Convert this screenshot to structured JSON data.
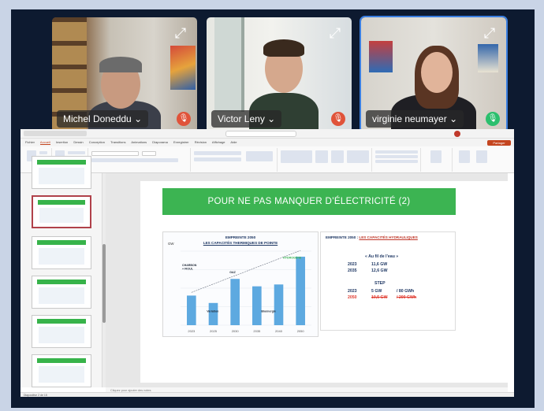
{
  "participants": [
    {
      "name": "Michel Doneddu",
      "mic": "muted"
    },
    {
      "name": "Victor Leny",
      "mic": "muted"
    },
    {
      "name": "virginie neumayer",
      "mic": "speaking"
    }
  ],
  "ribbon": {
    "tabs": [
      "Fichier",
      "Accueil",
      "Insertion",
      "Dessin",
      "Conception",
      "Transitions",
      "Animations",
      "Diaporama",
      "Enregistrer",
      "Révision",
      "Affichage",
      "Aide"
    ],
    "share_label": "Partager"
  },
  "slide": {
    "title": "POUR NE PAS MANQUER D’ÉLECTRICITÉ  (2)",
    "chart": {
      "title_line1": "EMPREINTE 2050",
      "title_line2": "LES CAPACITÉS THERMIQUES DE POINTE",
      "unit": "GW"
    },
    "info": {
      "heading_prefix": "EMPREINTE 2050 :",
      "heading_underlined": "LES CAPACITÉS HYDRAULIQUES",
      "group1_title": "« Au fil de l’eau »",
      "group1_rows": [
        {
          "year": "2023",
          "value": "11,6 GW"
        },
        {
          "year": "2035",
          "value": "12,6 GW"
        }
      ],
      "group2_title": "STEP",
      "group2_rows": [
        {
          "year": "2023",
          "value": "5 GW",
          "extra": "/ 80 GWh"
        },
        {
          "year": "2050",
          "value": "10,5 GW",
          "extra": "/ 200 GWh"
        }
      ]
    }
  },
  "notes_placeholder": "Cliquez pour ajouter des notes",
  "status_left": "Diapositive 2 de 15",
  "chart_data": {
    "type": "bar",
    "categories": [
      "2023",
      "2025",
      "2030",
      "2035",
      "2040",
      "2050"
    ],
    "values": [
      16,
      12,
      25,
      21,
      22,
      37
    ],
    "series_colors": [
      "#5da9e0"
    ],
    "ylim": [
      0,
      40
    ],
    "annotations": [
      "CHARBON",
      "+ FIOUL",
      "GAZ",
      "HYDROGÈNE",
      "Variation",
      "Bioénergie"
    ]
  }
}
